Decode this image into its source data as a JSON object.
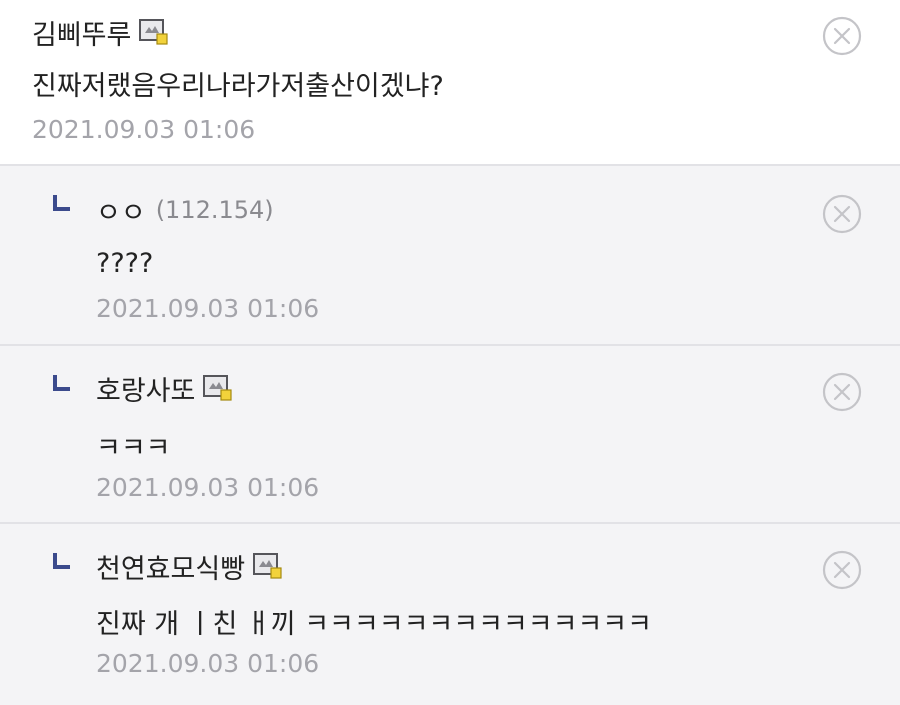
{
  "comments": [
    {
      "nickname": "김삐뚜루",
      "ip": "",
      "fixed_nick_icon": "fixed-nick-icon",
      "text": "진짜저랬음우리나라가저출산이겠냐?",
      "date": "2021.09.03 01:06",
      "is_reply": false
    },
    {
      "nickname": "ㅇㅇ",
      "ip": "(112.154)",
      "fixed_nick_icon": "",
      "text": "????",
      "date": "2021.09.03 01:06",
      "is_reply": true
    },
    {
      "nickname": "호랑사또",
      "ip": "",
      "fixed_nick_icon": "fixed-nick-icon",
      "text": "ㅋㅋㅋ",
      "date": "2021.09.03 01:06",
      "is_reply": true
    },
    {
      "nickname": "천연효모식빵",
      "ip": "",
      "fixed_nick_icon": "fixed-nick-icon",
      "text": "진짜 개 ㅣ친 ㅐ끼 ㅋㅋㅋㅋㅋㅋㅋㅋㅋㅋㅋㅋㅋㅋ",
      "date": "2021.09.03 01:06",
      "is_reply": true
    }
  ],
  "icons": {
    "delete": "delete-circle-x-icon",
    "reply": "reply-arrow-icon",
    "nick": "fixed-nick-icon"
  },
  "colors": {
    "reply_background": "#f4f4f6",
    "divider": "#e2e2e6",
    "date_text": "#a4a4aa",
    "reply_marker": "#3b4a8c"
  }
}
